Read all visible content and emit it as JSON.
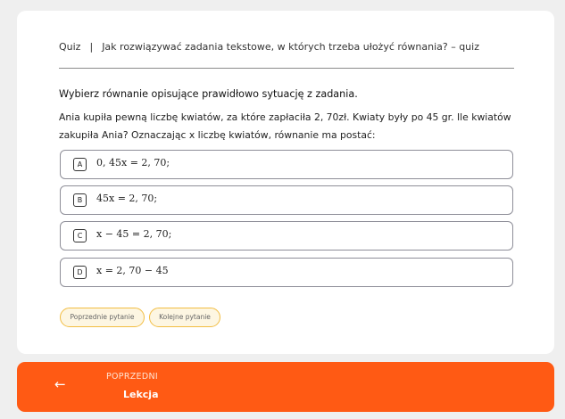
{
  "breadcrumb": {
    "section": "Quiz",
    "separator": "|",
    "title": "Jak rozwiązywać zadania tekstowe, w których trzeba ułożyć równania? – quiz"
  },
  "prompt": "Wybierz równanie opisujące prawidłowo sytuację z zadania.",
  "question": "Ania kupiła pewną liczbę kwiatów, za które zapłaciła 2, 70zł. Kwiaty były po 45 gr. Ile kwiatów zakupiła Ania? Oznaczając x liczbę kwiatów, równanie ma postać:",
  "options": [
    {
      "letter": "A",
      "formula": "0, 45x = 2, 70;"
    },
    {
      "letter": "B",
      "formula": "45x = 2, 70;"
    },
    {
      "letter": "C",
      "formula": "x − 45 = 2, 70;"
    },
    {
      "letter": "D",
      "formula": "x = 2, 70 − 45"
    }
  ],
  "nav": {
    "previous_question": "Poprzednie pytanie",
    "next_question": "Kolejne pytanie"
  },
  "footer": {
    "direction_label": "POPRZEDNI",
    "target_label": "Lekcja",
    "arrow_icon": "arrow-left-icon"
  },
  "colors": {
    "accent": "#ff5a14",
    "nav_border": "#f2bd42",
    "background": "#efefef"
  }
}
